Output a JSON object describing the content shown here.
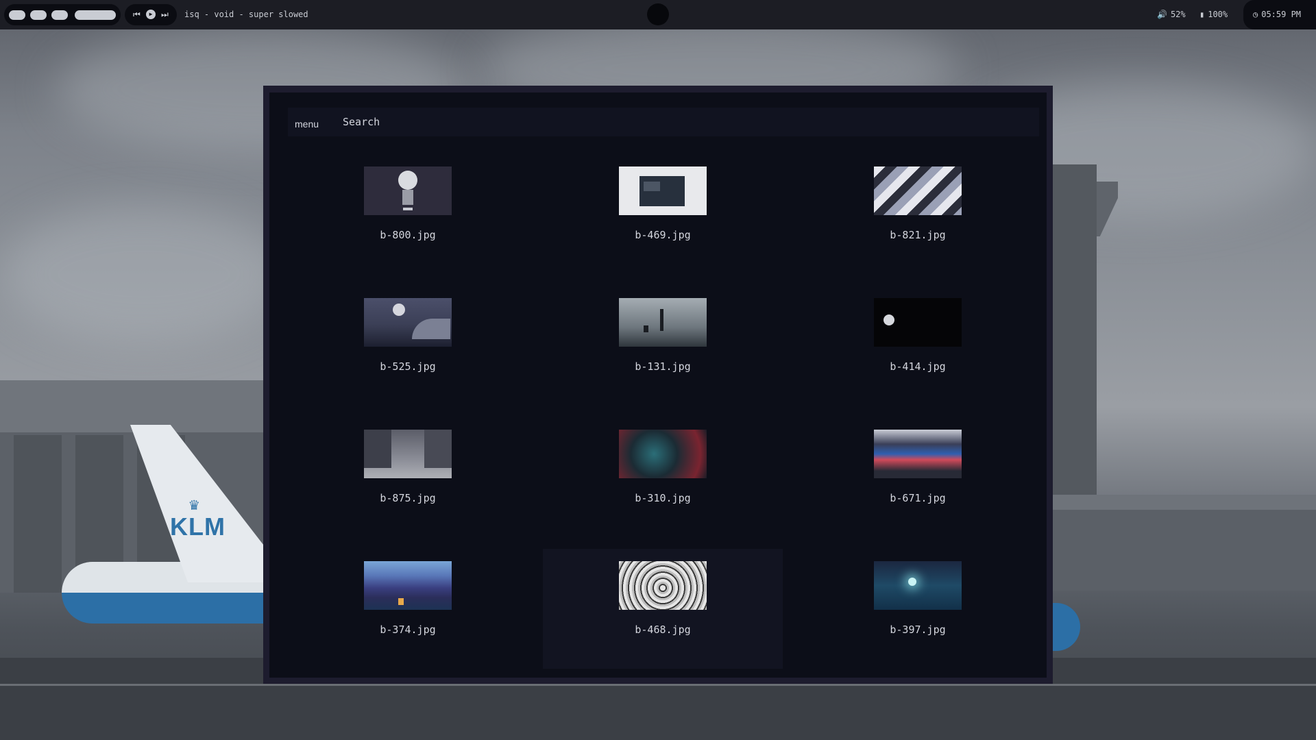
{
  "topbar": {
    "workspaces": [
      "1",
      "2",
      "3",
      "4"
    ],
    "active_workspace": 4,
    "media": {
      "prev_icon": "⏮",
      "play_icon": "▶",
      "next_icon": "⏭",
      "track": "isq - void - super slowed"
    },
    "volume": {
      "icon": "🔊",
      "text": "52%"
    },
    "battery": {
      "icon": "▮",
      "text": "100%"
    },
    "clock": {
      "icon": "◷",
      "text": "05:59 PM"
    }
  },
  "launcher": {
    "mode_label": "menu",
    "search_placeholder": "Search",
    "selected_index": 10,
    "items": [
      {
        "name": "b-800.jpg",
        "thumb": "t800"
      },
      {
        "name": "b-469.jpg",
        "thumb": "t469"
      },
      {
        "name": "b-821.jpg",
        "thumb": "t821"
      },
      {
        "name": "b-525.jpg",
        "thumb": "t525"
      },
      {
        "name": "b-131.jpg",
        "thumb": "t131"
      },
      {
        "name": "b-414.jpg",
        "thumb": "t414"
      },
      {
        "name": "b-875.jpg",
        "thumb": "t875"
      },
      {
        "name": "b-310.jpg",
        "thumb": "t310"
      },
      {
        "name": "b-671.jpg",
        "thumb": "t671"
      },
      {
        "name": "b-374.jpg",
        "thumb": "t374"
      },
      {
        "name": "b-468.jpg",
        "thumb": "t468"
      },
      {
        "name": "b-397.jpg",
        "thumb": "t397"
      }
    ]
  },
  "colors": {
    "bar_bg": "#1c1d24",
    "pill_bg": "#0b0c12",
    "launcher_bg": "#0c0e18",
    "launcher_border": "#1d1c2e",
    "text": "#d4d6de"
  }
}
